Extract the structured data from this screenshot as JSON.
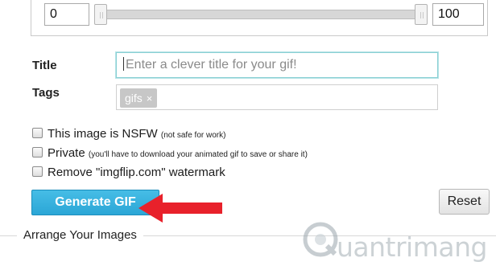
{
  "range": {
    "start_value": "0",
    "end_value": "100"
  },
  "form": {
    "title_label": "Title",
    "title_placeholder": "Enter a clever title for your gif!",
    "tags_label": "Tags",
    "tags": [
      {
        "label": "gifs",
        "remove_glyph": "×"
      }
    ]
  },
  "options": [
    {
      "label": "This image is NSFW",
      "note": "(not safe for work)",
      "checked": false
    },
    {
      "label": "Private",
      "note": "(you'll have to download your animated gif to save or share it)",
      "checked": false
    },
    {
      "label": "Remove \"imgflip.com\" watermark",
      "note": "",
      "checked": false
    }
  ],
  "buttons": {
    "generate": "Generate GIF",
    "reset": "Reset"
  },
  "section": {
    "arrange_label": "Arrange Your Images"
  },
  "annotation": {
    "arrow_color": "#e8212b",
    "arrow_direction": "left"
  },
  "watermark": {
    "text": "uantrimang",
    "icon": "quantrimang-logo-icon"
  },
  "colors": {
    "accent": "#2ba6d6",
    "focus_border": "#8ad0d4"
  }
}
